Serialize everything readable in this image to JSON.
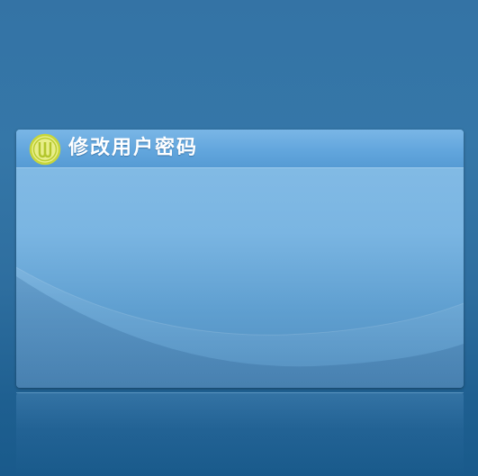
{
  "dialog": {
    "title": "修改用户密码"
  },
  "colors": {
    "background": "#3473a5",
    "panel_top": "#86bde6",
    "panel_bottom": "#4f8cbd",
    "header": "#62a6dd",
    "logo_ring": "#cfe04a"
  },
  "icons": {
    "logo": "company-logo-icon"
  }
}
